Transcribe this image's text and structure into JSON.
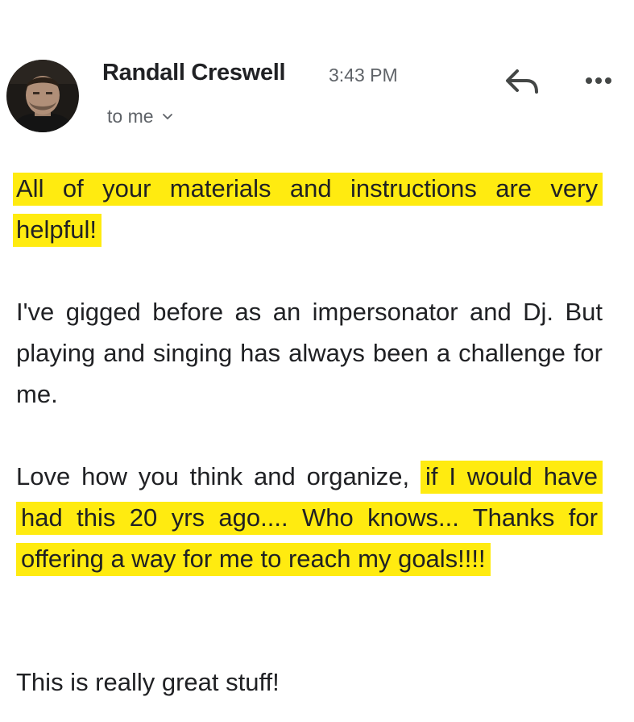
{
  "email": {
    "sender_name": "Randall Creswell",
    "time": "3:43 PM",
    "recipient_label": "to me",
    "avatar_icon": "person-avatar",
    "actions": {
      "reply_icon": "reply-icon",
      "more_icon": "more-options-icon"
    },
    "body": {
      "p1_highlight": "All of your materials and instructions are very helpful!",
      "p2": "I've gigged before as an impersonator and Dj. But playing and singing has always been a challenge for me.",
      "p3_plain": "Love how you think and organize,",
      "p3_highlight": "if I would have had this 20 yrs ago.... Who knows... Thanks for offering a way for me to reach my goals!!!!",
      "p4": "This is really great stuff!"
    }
  },
  "colors": {
    "highlight": "#ffeb10",
    "text": "#202124",
    "secondary_text": "#5f6368"
  }
}
